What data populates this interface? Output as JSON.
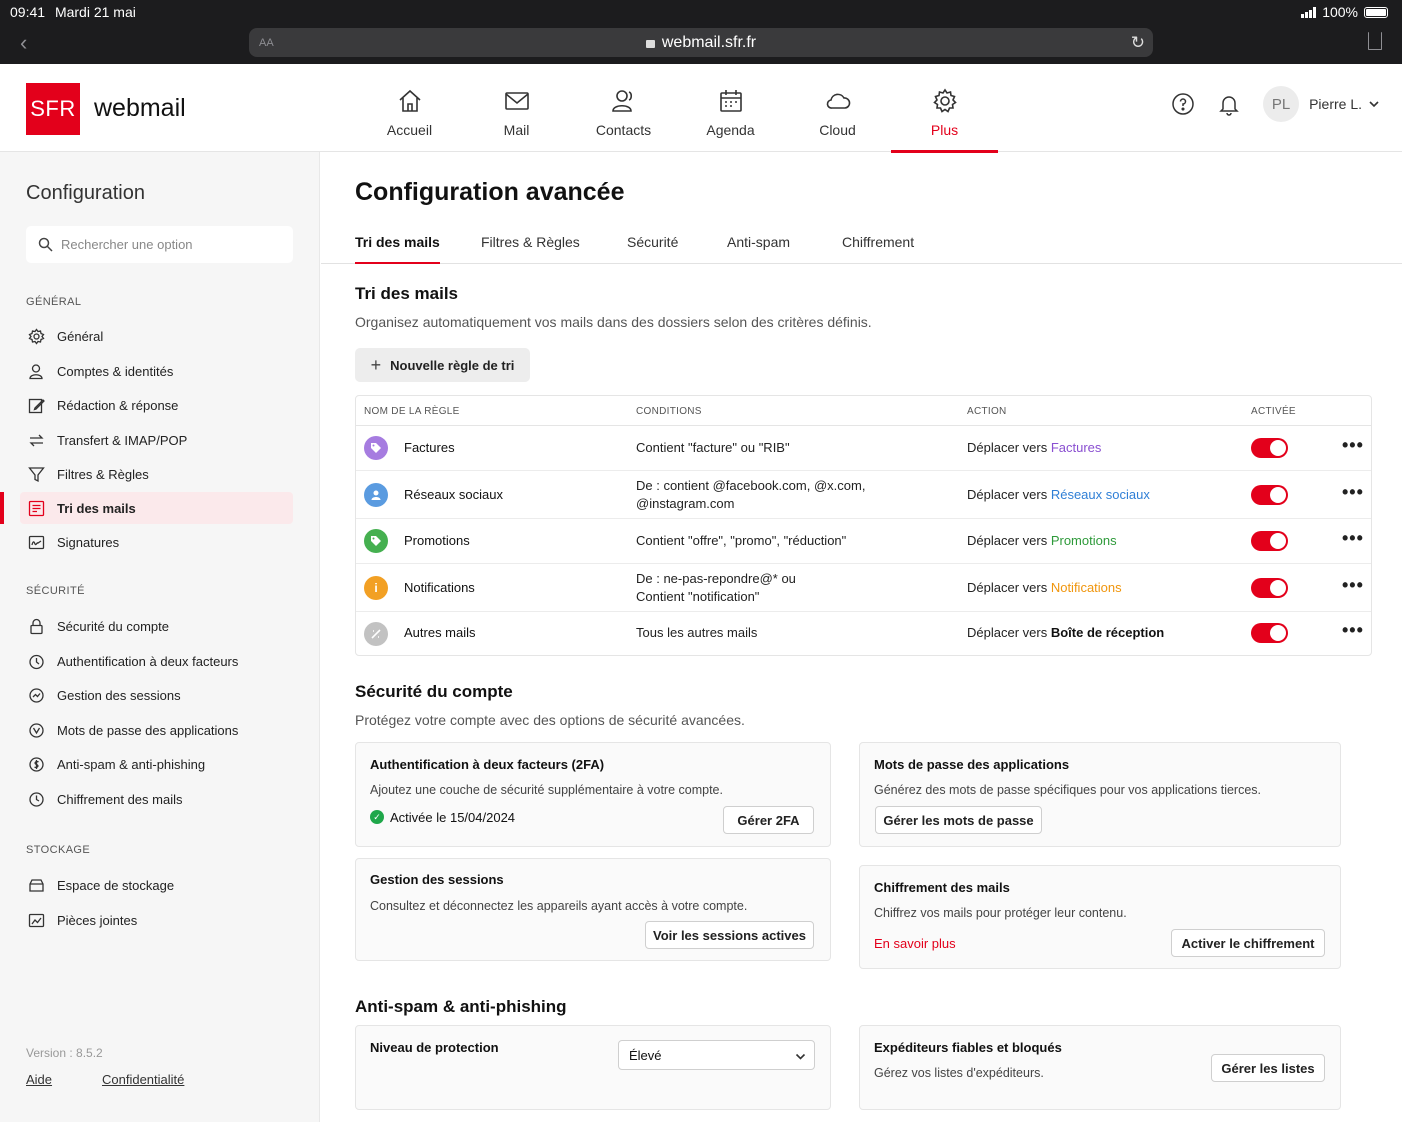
{
  "status": {
    "time": "09:41",
    "date": "Mardi 21 mai",
    "battery": "100%"
  },
  "browser": {
    "url": "webmail.sfr.fr",
    "reader_label": "AA"
  },
  "brand": {
    "logo": "SFR",
    "name": "webmail"
  },
  "nav": [
    {
      "label": "Accueil",
      "icon": "home-icon"
    },
    {
      "label": "Mail",
      "icon": "mail-icon"
    },
    {
      "label": "Contacts",
      "icon": "contacts-icon"
    },
    {
      "label": "Agenda",
      "icon": "calendar-icon"
    },
    {
      "label": "Cloud",
      "icon": "cloud-icon"
    },
    {
      "label": "Plus",
      "icon": "gear-icon",
      "active": true
    }
  ],
  "user": {
    "initials": "PL",
    "name": "Pierre L."
  },
  "sidebar": {
    "title": "Configuration",
    "search_placeholder": "Rechercher une option",
    "sections": {
      "general": "GÉNÉRAL",
      "security": "SÉCURITÉ",
      "storage": "STOCKAGE"
    },
    "general_items": [
      {
        "label": "Général",
        "icon": "gear-icon"
      },
      {
        "label": "Comptes & identités",
        "icon": "user-icon"
      },
      {
        "label": "Rédaction & réponse",
        "icon": "edit-icon"
      },
      {
        "label": "Transfert & IMAP/POP",
        "icon": "transfer-icon"
      },
      {
        "label": "Filtres & Règles",
        "icon": "filter-icon"
      },
      {
        "label": "Tri des mails",
        "icon": "sort-icon",
        "active": true
      },
      {
        "label": "Signatures",
        "icon": "signature-icon"
      }
    ],
    "security_items": [
      {
        "label": "Sécurité du compte",
        "icon": "lock-icon"
      },
      {
        "label": "Authentification à deux facteurs",
        "icon": "shield-icon"
      },
      {
        "label": "Gestion des sessions",
        "icon": "sessions-icon"
      },
      {
        "label": "Mots de passe des applications",
        "icon": "key-icon"
      },
      {
        "label": "Anti-spam & anti-phishing",
        "icon": "antispam-icon"
      },
      {
        "label": "Chiffrement des mails",
        "icon": "encrypt-icon"
      }
    ],
    "storage_items": [
      {
        "label": "Espace de stockage",
        "icon": "storage-icon"
      },
      {
        "label": "Pièces jointes",
        "icon": "attachment-icon"
      }
    ],
    "version": "Version : 8.5.2",
    "help_link": "Aide",
    "privacy_link": "Confidentialité"
  },
  "main": {
    "title": "Configuration avancée",
    "tabs": [
      {
        "label": "Tri des mails",
        "active": true
      },
      {
        "label": "Filtres & Règles"
      },
      {
        "label": "Sécurité"
      },
      {
        "label": "Anti-spam"
      },
      {
        "label": "Chiffrement"
      }
    ],
    "sort": {
      "title": "Tri des mails",
      "description": "Organisez automatiquement vos mails dans des dossiers selon des critères définis.",
      "new_rule_label": "Nouvelle règle de tri",
      "columns": [
        "NOM DE LA RÈGLE",
        "CONDITIONS",
        "ACTION",
        "ACTIVÉE"
      ],
      "action_prefix": "Déplacer vers",
      "rules": [
        {
          "name": "Factures",
          "condition": "Contient \"facture\" ou \"RIB\"",
          "target": "Factures",
          "target_color": "#8a4fd1",
          "icon": "tag-icon",
          "icon_color": "#a67ce0",
          "enabled": true
        },
        {
          "name": "Réseaux sociaux",
          "condition": "De : contient @facebook.com, @x.com, @instagram.com",
          "target": "Réseaux sociaux",
          "target_color": "#2f7fd6",
          "icon": "person-icon",
          "icon_color": "#5a9be0",
          "enabled": true
        },
        {
          "name": "Promotions",
          "condition": "Contient \"offre\", \"promo\", \"réduction\"",
          "target": "Promotions",
          "target_color": "#2e9a3a",
          "icon": "tag-icon",
          "icon_color": "#45b050",
          "enabled": true
        },
        {
          "name": "Notifications",
          "condition": "De : ne-pas-repondre@* ou Contient \"notification\"",
          "target": "Notifications",
          "target_color": "#f0960e",
          "icon": "info-icon",
          "icon_color": "#f2a024",
          "enabled": true
        },
        {
          "name": "Autres mails",
          "condition": "Tous les autres mails",
          "target": "Boîte de réception",
          "target_color": "#111111",
          "icon": "other-icon",
          "icon_color": "#c2c2c2",
          "enabled": true
        }
      ]
    },
    "security": {
      "title": "Sécurité du compte",
      "description": "Protégez votre compte avec des options de sécurité avancées.",
      "twofa": {
        "title": "Authentification à deux facteurs (2FA)",
        "description": "Ajoutez une couche de sécurité supplémentaire à votre compte.",
        "status": "Activée le 15/04/2024",
        "button": "Gérer 2FA"
      },
      "app_passwords": {
        "title": "Mots de passe des applications",
        "description": "Générez des mots de passe spécifiques pour vos applications tierces.",
        "button": "Gérer les mots de passe"
      },
      "sessions": {
        "title": "Gestion des sessions",
        "description": "Consultez et déconnectez les appareils ayant accès à votre compte.",
        "button": "Voir les sessions actives"
      },
      "encryption": {
        "title": "Chiffrement des mails",
        "description": "Chiffrez vos mails pour protéger leur contenu.",
        "link": "En savoir plus",
        "button": "Activer le chiffrement"
      }
    },
    "antispam": {
      "title": "Anti-spam & anti-phishing",
      "protection": {
        "label": "Niveau de protection",
        "value": "Élevé"
      },
      "senders": {
        "title": "Expéditeurs fiables et bloqués",
        "description": "Gérez vos listes d'expéditeurs.",
        "button": "Gérer les listes"
      }
    }
  },
  "colors": {
    "brand": "#e3001b"
  }
}
